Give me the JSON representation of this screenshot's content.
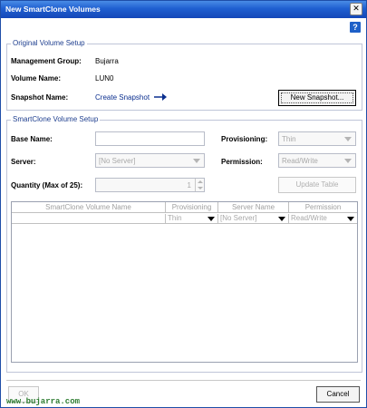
{
  "window": {
    "title": "New SmartClone Volumes",
    "close_glyph": "✕",
    "help_glyph": "?"
  },
  "original": {
    "legend": "Original Volume Setup",
    "mgmt_label": "Management Group:",
    "mgmt_value": "Bujarra",
    "volume_label": "Volume Name:",
    "volume_value": "LUN0",
    "snapshot_label": "Snapshot Name:",
    "snapshot_link": "Create Snapshot",
    "new_snapshot_button": "New Snapshot..."
  },
  "smartclone": {
    "legend": "SmartClone Volume Setup",
    "base_name_label": "Base Name:",
    "base_name_value": "",
    "provisioning_label": "Provisioning:",
    "provisioning_value": "Thin",
    "server_label": "Server:",
    "server_value": "[No Server]",
    "permission_label": "Permission:",
    "permission_value": "Read/Write",
    "quantity_label": "Quantity (Max of 25):",
    "quantity_value": "1",
    "update_table_button": "Update Table"
  },
  "table": {
    "columns": [
      "SmartClone Volume Name",
      "Provisioning",
      "Server Name",
      "Permission"
    ],
    "row": {
      "name": "",
      "provisioning": "Thin",
      "server": "[No Server]",
      "permission": "Read/Write"
    }
  },
  "footer": {
    "ok_button": "OK",
    "cancel_button": "Cancel",
    "watermark": "www.bujarra.com"
  },
  "colors": {
    "title_bar": "#1f5fd0",
    "legend_text": "#1f3f8f",
    "link_text": "#0b2f8f",
    "watermark": "#2e7d32"
  },
  "icons": [
    "close-icon",
    "help-icon",
    "arrow-right-icon",
    "chevron-down-icon",
    "spin-up-icon",
    "spin-down-icon"
  ]
}
